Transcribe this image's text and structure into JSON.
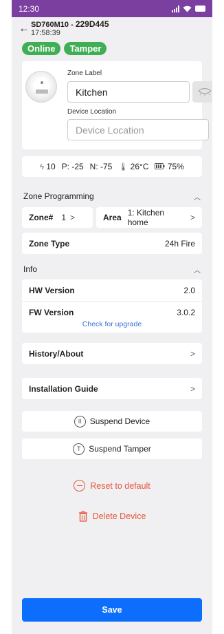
{
  "status_bar": {
    "time": "12:30"
  },
  "header": {
    "device_model": "SD760M10 - ",
    "device_id": "229D445",
    "time": "17:58:39"
  },
  "badges": [
    "Online",
    "Tamper"
  ],
  "device_card": {
    "zone_label_caption": "Zone Label",
    "zone_label_value": "Kitchen",
    "device_location_caption": "Device Location",
    "device_location_placeholder": "Device Location"
  },
  "stats": {
    "signal": "10",
    "p": "P: -25",
    "n": "N: -75",
    "temperature": "26°C",
    "battery": "75%"
  },
  "zone_programming": {
    "title": "Zone Programming",
    "zone_label": "Zone#",
    "zone_value": "1",
    "area_label": "Area",
    "area_value": "1: Kitchen home",
    "zone_type_label": "Zone Type",
    "zone_type_value": "24h Fire"
  },
  "info": {
    "title": "Info",
    "hw_label": "HW Version",
    "hw_value": "2.0",
    "fw_label": "FW Version",
    "fw_value": "3.0.2",
    "upgrade_link": "Check for upgrade"
  },
  "nav": {
    "history": "History/About",
    "install_guide": "Installation Guide"
  },
  "actions": {
    "suspend_device": "Suspend Device",
    "suspend_device_icon": "II",
    "suspend_tamper": "Suspend Tamper",
    "suspend_tamper_icon": "T",
    "reset": "Reset to default",
    "delete": "Delete Device"
  },
  "save_label": "Save",
  "colors": {
    "status_bar": "#7b3fa0",
    "badge": "#3fae55",
    "danger": "#e8553b",
    "primary": "#0d6efd",
    "link": "#3b6fd0"
  }
}
